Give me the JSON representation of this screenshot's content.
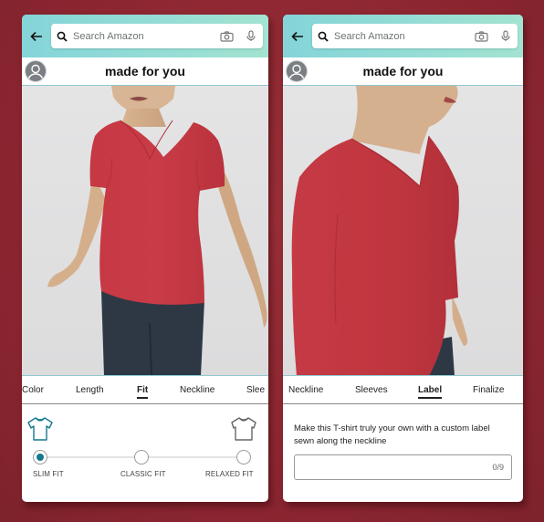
{
  "screens": [
    {
      "search": {
        "placeholder": "Search Amazon"
      },
      "header": {
        "title": "made for you"
      },
      "tabs": [
        {
          "label": "Color",
          "active": false
        },
        {
          "label": "Length",
          "active": false
        },
        {
          "label": "Fit",
          "active": true
        },
        {
          "label": "Neckline",
          "active": false
        },
        {
          "label": "Slee",
          "active": false
        }
      ],
      "fit": {
        "options": [
          {
            "label": "SLIM FIT",
            "selected": true
          },
          {
            "label": "CLASSIC FIT",
            "selected": false
          },
          {
            "label": "RELAXED FIT",
            "selected": false
          }
        ],
        "accent_color": "#137a8e"
      },
      "model": {
        "view": "front",
        "garment": "short-sleeve v-neck t-shirt",
        "garment_color": "#c93a44"
      }
    },
    {
      "search": {
        "placeholder": "Search Amazon"
      },
      "header": {
        "title": "made for you"
      },
      "tabs": [
        {
          "label": "Neckline",
          "active": false
        },
        {
          "label": "Sleeves",
          "active": false
        },
        {
          "label": "Label",
          "active": true
        },
        {
          "label": "Finalize",
          "active": false
        }
      ],
      "label_panel": {
        "description": "Make this T-shirt truly your own with a custom label sewn along the neckline",
        "value": "",
        "counter": "0/9"
      },
      "model": {
        "view": "side",
        "garment": "long-sleeve v-neck t-shirt",
        "garment_color": "#c93a44"
      }
    }
  ],
  "icons": {
    "back": "arrow-left",
    "search": "magnifier",
    "camera": "camera",
    "mic": "microphone",
    "avatar": "user-circle"
  }
}
